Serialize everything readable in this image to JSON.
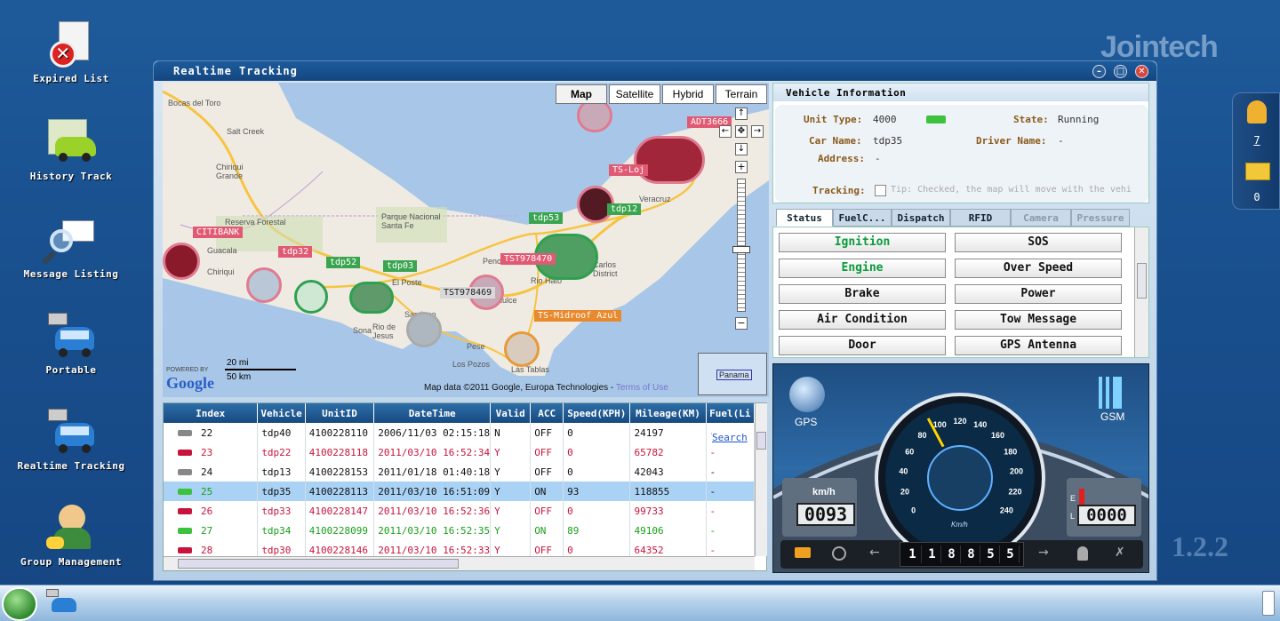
{
  "brand": "Jointech",
  "version": "1.2.2",
  "desktop_icons": [
    {
      "label": "Expired List",
      "icon": "expired-list-icon"
    },
    {
      "label": "History Track",
      "icon": "history-track-icon"
    },
    {
      "label": "Message Listing",
      "icon": "message-listing-icon"
    },
    {
      "label": "Portable",
      "icon": "portable-icon"
    },
    {
      "label": "Realtime Tracking",
      "icon": "realtime-tracking-icon"
    },
    {
      "label": "Group Management",
      "icon": "group-management-icon"
    }
  ],
  "window": {
    "title": "Realtime Tracking"
  },
  "map": {
    "types": [
      "Map",
      "Satellite",
      "Hybrid",
      "Terrain"
    ],
    "selected_type": "Map",
    "scale_mi": "20 mi",
    "scale_km": "50 km",
    "powered_by": "POWERED BY",
    "google": "Google",
    "attribution": "Map data ©2011 Google, Europa Technologies -",
    "terms": "Terms of Use",
    "overview_label": "Panama",
    "places": [
      "Bocas del Toro",
      "Salt Creek",
      "Chiriqui Grande",
      "Reserva Forestal",
      "Parque Nacional Santa Fe",
      "Guacala",
      "Chiriqui",
      "El Poste",
      "Santiago",
      "Rio de Jesus",
      "Sona",
      "Pese",
      "Los Pozos",
      "Las Tablas",
      "Carlos District",
      "Rio Hato",
      "Penonome",
      "Aguadulce",
      "Veracruz"
    ],
    "vehicle_labels": [
      {
        "text": "CITIBANK",
        "color": "pink"
      },
      {
        "text": "tdp32",
        "color": "pink"
      },
      {
        "text": "tdp52",
        "color": "green"
      },
      {
        "text": "tdp03",
        "color": "green"
      },
      {
        "text": "TST978470",
        "color": "pink"
      },
      {
        "text": "TST978469",
        "color": "grey"
      },
      {
        "text": "TS-Midroof Azul",
        "color": "orange"
      },
      {
        "text": "tdp53",
        "color": "green"
      },
      {
        "text": "tdp12",
        "color": "green"
      },
      {
        "text": "ADT3666",
        "color": "pink"
      },
      {
        "text": "TS-Loj",
        "color": "pink"
      }
    ]
  },
  "grid": {
    "columns": [
      "Index",
      "Vehicle",
      "UnitID",
      "DateTime",
      "Valid",
      "ACC",
      "Speed(KPH)",
      "Mileage(KM)",
      "Fuel(Li"
    ],
    "search_label": "Search",
    "rows": [
      {
        "index": "22",
        "vehicle": "tdp40",
        "unit": "4100228110",
        "datetime": "2006/11/03 02:15:18",
        "valid": "N",
        "acc": "OFF",
        "speed": "0",
        "mileage": "24197",
        "fuel": "-",
        "state": "offline"
      },
      {
        "index": "23",
        "vehicle": "tdp22",
        "unit": "4100228118",
        "datetime": "2011/03/10 16:52:34",
        "valid": "Y",
        "acc": "OFF",
        "speed": "0",
        "mileage": "65782",
        "fuel": "-",
        "state": "alarm"
      },
      {
        "index": "24",
        "vehicle": "tdp13",
        "unit": "4100228153",
        "datetime": "2011/01/18 01:40:18",
        "valid": "Y",
        "acc": "OFF",
        "speed": "0",
        "mileage": "42043",
        "fuel": "-",
        "state": "offline"
      },
      {
        "index": "25",
        "vehicle": "tdp35",
        "unit": "4100228113",
        "datetime": "2011/03/10 16:51:09",
        "valid": "Y",
        "acc": "ON",
        "speed": "93",
        "mileage": "118855",
        "fuel": "-",
        "state": "selected"
      },
      {
        "index": "26",
        "vehicle": "tdp33",
        "unit": "4100228147",
        "datetime": "2011/03/10 16:52:36",
        "valid": "Y",
        "acc": "OFF",
        "speed": "0",
        "mileage": "99733",
        "fuel": "-",
        "state": "alarm"
      },
      {
        "index": "27",
        "vehicle": "tdp34",
        "unit": "4100228099",
        "datetime": "2011/03/10 16:52:35",
        "valid": "Y",
        "acc": "ON",
        "speed": "89",
        "mileage": "49106",
        "fuel": "-",
        "state": "running"
      },
      {
        "index": "28",
        "vehicle": "tdp30",
        "unit": "4100228146",
        "datetime": "2011/03/10 16:52:33",
        "valid": "Y",
        "acc": "OFF",
        "speed": "0",
        "mileage": "64352",
        "fuel": "-",
        "state": "alarm"
      }
    ]
  },
  "vehicle_info": {
    "heading": "Vehicle Information",
    "unit_type_label": "Unit Type:",
    "unit_type": "4000",
    "state_label": "State:",
    "state": "Running",
    "car_name_label": "Car Name:",
    "car_name": "tdp35",
    "driver_name_label": "Driver Name:",
    "driver_name": "-",
    "address_label": "Address:",
    "address": "-",
    "tracking_label": "Tracking:",
    "tracking_tip": "Tip: Checked, the map will move with the vehi"
  },
  "tabs": [
    "Status",
    "FuelC...",
    "Dispatch",
    "RFID",
    "Camera",
    "Pressure"
  ],
  "status_buttons": [
    {
      "label": "Ignition",
      "active": true
    },
    {
      "label": "SOS",
      "active": false
    },
    {
      "label": "Engine",
      "active": true
    },
    {
      "label": "Over Speed",
      "active": false
    },
    {
      "label": "Brake",
      "active": false
    },
    {
      "label": "Power",
      "active": false
    },
    {
      "label": "Air Condition",
      "active": false
    },
    {
      "label": "Tow Message",
      "active": false
    },
    {
      "label": "Door",
      "active": false
    },
    {
      "label": "GPS Antenna",
      "active": false
    }
  ],
  "dashboard": {
    "gps": "GPS",
    "gsm": "GSM",
    "speed_unit": "km/h",
    "speed_display": "0093",
    "fuel_display": "0000",
    "fuel_e": "E",
    "fuel_l": "L",
    "gauge_unit": "Km/h",
    "gauge_ticks": [
      "0",
      "20",
      "40",
      "60",
      "80",
      "100",
      "120",
      "140",
      "160",
      "180",
      "200",
      "220",
      "240"
    ],
    "speed_value": 93,
    "odometer": [
      "1",
      "1",
      "8",
      "8",
      "5",
      "5"
    ]
  },
  "sidebar": {
    "alerts": "7",
    "messages": "0"
  },
  "colors": {
    "selected_row": "#a9d2f5",
    "alarm_text": "#c8143c",
    "running_text": "#18a018",
    "active_button": "#0a9a3a"
  }
}
